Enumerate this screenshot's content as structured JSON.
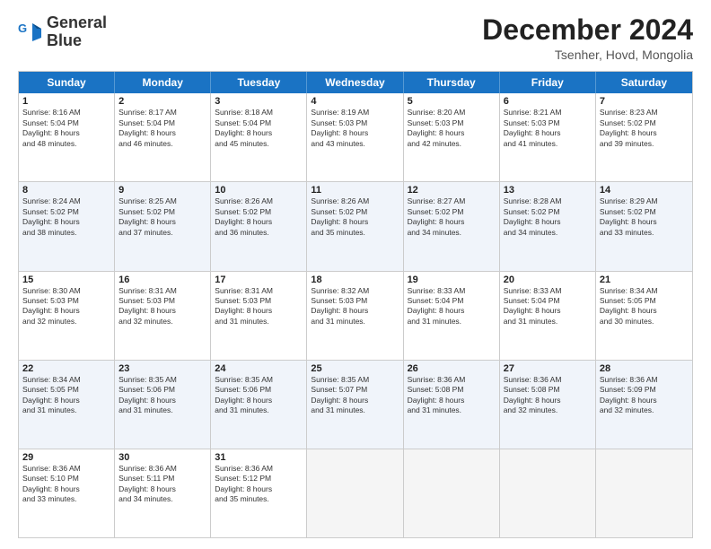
{
  "logo": {
    "line1": "General",
    "line2": "Blue"
  },
  "title": "December 2024",
  "subtitle": "Tsenher, Hovd, Mongolia",
  "header_days": [
    "Sunday",
    "Monday",
    "Tuesday",
    "Wednesday",
    "Thursday",
    "Friday",
    "Saturday"
  ],
  "rows": [
    {
      "alt": false,
      "cells": [
        {
          "day": "1",
          "lines": [
            "Sunrise: 8:16 AM",
            "Sunset: 5:04 PM",
            "Daylight: 8 hours",
            "and 48 minutes."
          ]
        },
        {
          "day": "2",
          "lines": [
            "Sunrise: 8:17 AM",
            "Sunset: 5:04 PM",
            "Daylight: 8 hours",
            "and 46 minutes."
          ]
        },
        {
          "day": "3",
          "lines": [
            "Sunrise: 8:18 AM",
            "Sunset: 5:04 PM",
            "Daylight: 8 hours",
            "and 45 minutes."
          ]
        },
        {
          "day": "4",
          "lines": [
            "Sunrise: 8:19 AM",
            "Sunset: 5:03 PM",
            "Daylight: 8 hours",
            "and 43 minutes."
          ]
        },
        {
          "day": "5",
          "lines": [
            "Sunrise: 8:20 AM",
            "Sunset: 5:03 PM",
            "Daylight: 8 hours",
            "and 42 minutes."
          ]
        },
        {
          "day": "6",
          "lines": [
            "Sunrise: 8:21 AM",
            "Sunset: 5:03 PM",
            "Daylight: 8 hours",
            "and 41 minutes."
          ]
        },
        {
          "day": "7",
          "lines": [
            "Sunrise: 8:23 AM",
            "Sunset: 5:02 PM",
            "Daylight: 8 hours",
            "and 39 minutes."
          ]
        }
      ]
    },
    {
      "alt": true,
      "cells": [
        {
          "day": "8",
          "lines": [
            "Sunrise: 8:24 AM",
            "Sunset: 5:02 PM",
            "Daylight: 8 hours",
            "and 38 minutes."
          ]
        },
        {
          "day": "9",
          "lines": [
            "Sunrise: 8:25 AM",
            "Sunset: 5:02 PM",
            "Daylight: 8 hours",
            "and 37 minutes."
          ]
        },
        {
          "day": "10",
          "lines": [
            "Sunrise: 8:26 AM",
            "Sunset: 5:02 PM",
            "Daylight: 8 hours",
            "and 36 minutes."
          ]
        },
        {
          "day": "11",
          "lines": [
            "Sunrise: 8:26 AM",
            "Sunset: 5:02 PM",
            "Daylight: 8 hours",
            "and 35 minutes."
          ]
        },
        {
          "day": "12",
          "lines": [
            "Sunrise: 8:27 AM",
            "Sunset: 5:02 PM",
            "Daylight: 8 hours",
            "and 34 minutes."
          ]
        },
        {
          "day": "13",
          "lines": [
            "Sunrise: 8:28 AM",
            "Sunset: 5:02 PM",
            "Daylight: 8 hours",
            "and 34 minutes."
          ]
        },
        {
          "day": "14",
          "lines": [
            "Sunrise: 8:29 AM",
            "Sunset: 5:02 PM",
            "Daylight: 8 hours",
            "and 33 minutes."
          ]
        }
      ]
    },
    {
      "alt": false,
      "cells": [
        {
          "day": "15",
          "lines": [
            "Sunrise: 8:30 AM",
            "Sunset: 5:03 PM",
            "Daylight: 8 hours",
            "and 32 minutes."
          ]
        },
        {
          "day": "16",
          "lines": [
            "Sunrise: 8:31 AM",
            "Sunset: 5:03 PM",
            "Daylight: 8 hours",
            "and 32 minutes."
          ]
        },
        {
          "day": "17",
          "lines": [
            "Sunrise: 8:31 AM",
            "Sunset: 5:03 PM",
            "Daylight: 8 hours",
            "and 31 minutes."
          ]
        },
        {
          "day": "18",
          "lines": [
            "Sunrise: 8:32 AM",
            "Sunset: 5:03 PM",
            "Daylight: 8 hours",
            "and 31 minutes."
          ]
        },
        {
          "day": "19",
          "lines": [
            "Sunrise: 8:33 AM",
            "Sunset: 5:04 PM",
            "Daylight: 8 hours",
            "and 31 minutes."
          ]
        },
        {
          "day": "20",
          "lines": [
            "Sunrise: 8:33 AM",
            "Sunset: 5:04 PM",
            "Daylight: 8 hours",
            "and 31 minutes."
          ]
        },
        {
          "day": "21",
          "lines": [
            "Sunrise: 8:34 AM",
            "Sunset: 5:05 PM",
            "Daylight: 8 hours",
            "and 30 minutes."
          ]
        }
      ]
    },
    {
      "alt": true,
      "cells": [
        {
          "day": "22",
          "lines": [
            "Sunrise: 8:34 AM",
            "Sunset: 5:05 PM",
            "Daylight: 8 hours",
            "and 31 minutes."
          ]
        },
        {
          "day": "23",
          "lines": [
            "Sunrise: 8:35 AM",
            "Sunset: 5:06 PM",
            "Daylight: 8 hours",
            "and 31 minutes."
          ]
        },
        {
          "day": "24",
          "lines": [
            "Sunrise: 8:35 AM",
            "Sunset: 5:06 PM",
            "Daylight: 8 hours",
            "and 31 minutes."
          ]
        },
        {
          "day": "25",
          "lines": [
            "Sunrise: 8:35 AM",
            "Sunset: 5:07 PM",
            "Daylight: 8 hours",
            "and 31 minutes."
          ]
        },
        {
          "day": "26",
          "lines": [
            "Sunrise: 8:36 AM",
            "Sunset: 5:08 PM",
            "Daylight: 8 hours",
            "and 31 minutes."
          ]
        },
        {
          "day": "27",
          "lines": [
            "Sunrise: 8:36 AM",
            "Sunset: 5:08 PM",
            "Daylight: 8 hours",
            "and 32 minutes."
          ]
        },
        {
          "day": "28",
          "lines": [
            "Sunrise: 8:36 AM",
            "Sunset: 5:09 PM",
            "Daylight: 8 hours",
            "and 32 minutes."
          ]
        }
      ]
    },
    {
      "alt": false,
      "cells": [
        {
          "day": "29",
          "lines": [
            "Sunrise: 8:36 AM",
            "Sunset: 5:10 PM",
            "Daylight: 8 hours",
            "and 33 minutes."
          ]
        },
        {
          "day": "30",
          "lines": [
            "Sunrise: 8:36 AM",
            "Sunset: 5:11 PM",
            "Daylight: 8 hours",
            "and 34 minutes."
          ]
        },
        {
          "day": "31",
          "lines": [
            "Sunrise: 8:36 AM",
            "Sunset: 5:12 PM",
            "Daylight: 8 hours",
            "and 35 minutes."
          ]
        },
        {
          "day": "",
          "lines": []
        },
        {
          "day": "",
          "lines": []
        },
        {
          "day": "",
          "lines": []
        },
        {
          "day": "",
          "lines": []
        }
      ]
    }
  ]
}
